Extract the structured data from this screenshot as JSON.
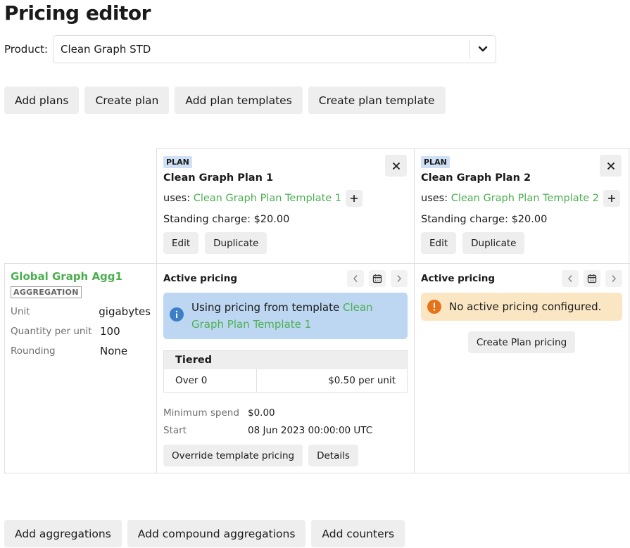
{
  "page": {
    "title": "Pricing editor"
  },
  "product": {
    "label": "Product:",
    "selected": "Clean Graph STD"
  },
  "top_actions": [
    "Add plans",
    "Create plan",
    "Add plan templates",
    "Create plan template"
  ],
  "plans": [
    {
      "tag": "PLAN",
      "name": "Clean Graph Plan 1",
      "uses_label": "uses:",
      "template": "Clean Graph Plan Template 1",
      "standing_charge": "Standing charge: $20.00",
      "edit_label": "Edit",
      "duplicate_label": "Duplicate"
    },
    {
      "tag": "PLAN",
      "name": "Clean Graph Plan 2",
      "uses_label": "uses:",
      "template": "Clean Graph Plan Template 2",
      "standing_charge": "Standing charge: $20.00",
      "edit_label": "Edit",
      "duplicate_label": "Duplicate"
    }
  ],
  "aggregation": {
    "name": "Global Graph Agg1",
    "tag": "AGGREGATION",
    "props": [
      {
        "key": "Unit",
        "value": "gigabytes"
      },
      {
        "key": "Quantity per unit",
        "value": "100"
      },
      {
        "key": "Rounding",
        "value": "None"
      }
    ]
  },
  "pricing": [
    {
      "title": "Active pricing",
      "info_text": "Using pricing from template ",
      "info_link": "Clean Graph Plan Template 1",
      "tier_header": "Tiered",
      "tier_from": "Over 0",
      "tier_price": "$0.50 per unit",
      "min_spend_label": "Minimum spend",
      "min_spend_value": "$0.00",
      "start_label": "Start",
      "start_value": "08 Jun 2023 00:00:00 UTC",
      "override_label": "Override template pricing",
      "details_label": "Details"
    },
    {
      "title": "Active pricing",
      "warning_text": "No active pricing configured.",
      "create_label": "Create Plan pricing"
    }
  ],
  "bottom_actions": [
    "Add aggregations",
    "Add compound aggregations",
    "Add counters"
  ],
  "colors": {
    "link": "#4caf50",
    "info_bg": "#bdd7f2",
    "info_icon": "#3d7fc6",
    "warn_bg": "#fbe6c3",
    "warn_icon": "#e5731a",
    "plan_tag_bg": "#cfe0f5"
  }
}
